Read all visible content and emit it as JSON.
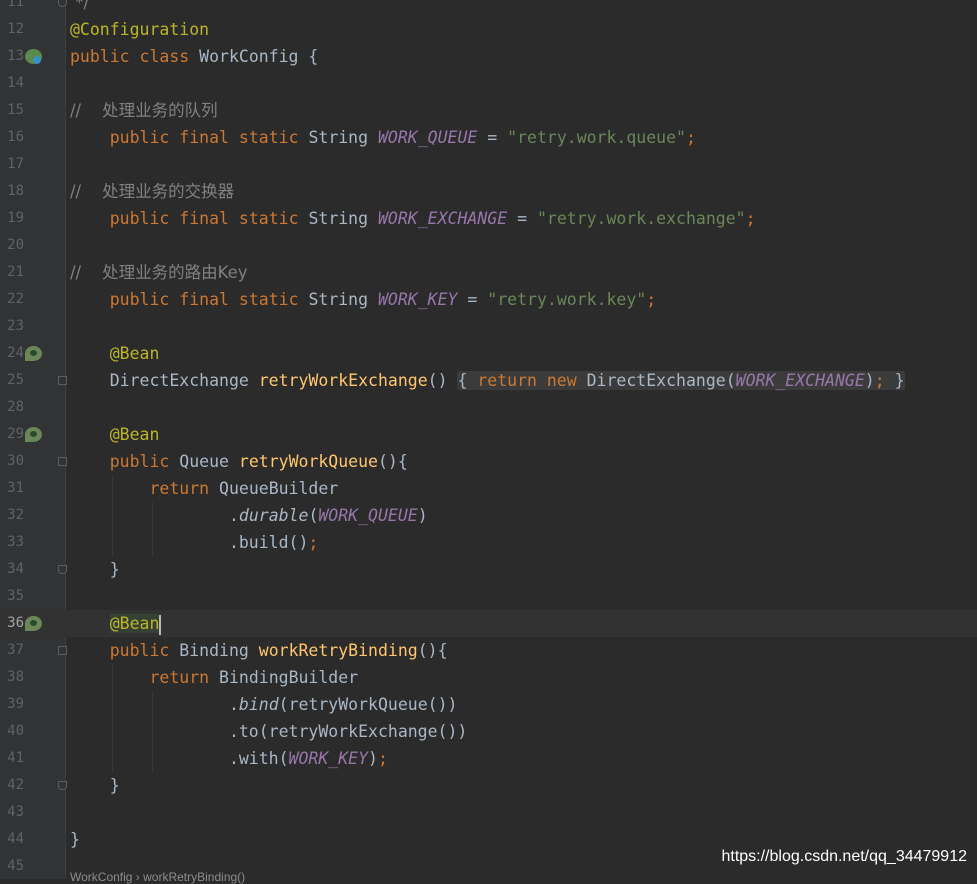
{
  "editor": {
    "lines": [
      {
        "num": "11",
        "text": " */"
      },
      {
        "num": "12",
        "text": "@Configuration"
      },
      {
        "num": "13",
        "text": "public class WorkConfig {"
      },
      {
        "num": "14",
        "text": ""
      },
      {
        "num": "15",
        "text": "//    处理业务的队列"
      },
      {
        "num": "16",
        "text": "    public final static String WORK_QUEUE = \"retry.work.queue\";"
      },
      {
        "num": "17",
        "text": ""
      },
      {
        "num": "18",
        "text": "//    处理业务的交换器"
      },
      {
        "num": "19",
        "text": "    public final static String WORK_EXCHANGE = \"retry.work.exchange\";"
      },
      {
        "num": "20",
        "text": ""
      },
      {
        "num": "21",
        "text": "//    处理业务的路由Key"
      },
      {
        "num": "22",
        "text": "    public final static String WORK_KEY = \"retry.work.key\";"
      },
      {
        "num": "23",
        "text": ""
      },
      {
        "num": "24",
        "text": "    @Bean"
      },
      {
        "num": "25",
        "text": "    DirectExchange retryWorkExchange() { return new DirectExchange(WORK_EXCHANGE); }"
      },
      {
        "num": "28",
        "text": ""
      },
      {
        "num": "29",
        "text": "    @Bean"
      },
      {
        "num": "30",
        "text": "    public Queue retryWorkQueue(){"
      },
      {
        "num": "31",
        "text": "        return QueueBuilder"
      },
      {
        "num": "32",
        "text": "                .durable(WORK_QUEUE)"
      },
      {
        "num": "33",
        "text": "                .build();"
      },
      {
        "num": "34",
        "text": "    }"
      },
      {
        "num": "35",
        "text": ""
      },
      {
        "num": "36",
        "text": "    @Bean"
      },
      {
        "num": "37",
        "text": "    public Binding workRetryBinding(){"
      },
      {
        "num": "38",
        "text": "        return BindingBuilder"
      },
      {
        "num": "39",
        "text": "                .bind(retryWorkQueue())"
      },
      {
        "num": "40",
        "text": "                .to(retryWorkExchange())"
      },
      {
        "num": "41",
        "text": "                .with(WORK_KEY);"
      },
      {
        "num": "42",
        "text": "    }"
      },
      {
        "num": "43",
        "text": ""
      },
      {
        "num": "44",
        "text": "}"
      },
      {
        "num": "45",
        "text": ""
      }
    ]
  },
  "watermark": "https://blog.csdn.net/qq_34479912",
  "breadcrumb": "WorkConfig  ›  workRetryBinding()",
  "colors": {
    "background": "#2b2b2b",
    "gutter": "#313335",
    "keyword": "#cc7832",
    "annotation": "#bbb529",
    "method": "#ffc66d",
    "string": "#6a8759",
    "constant": "#9876aa",
    "comment": "#808080",
    "text": "#a9b7c6"
  }
}
